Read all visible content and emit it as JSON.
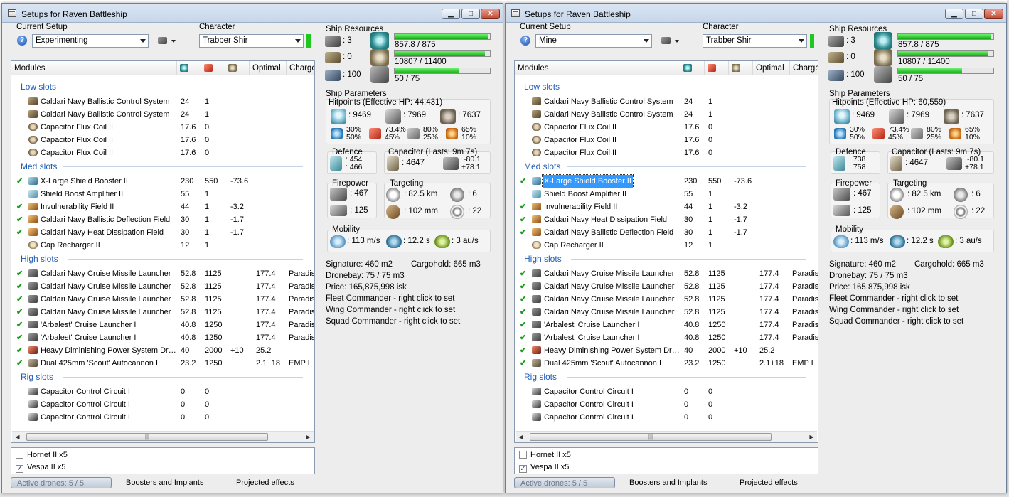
{
  "windows": [
    {
      "title": "Setups for Raven Battleship",
      "setup_label": "Current Setup",
      "setup_value": "Experimenting",
      "character_label": "Character",
      "character_value": "Trabber Shir",
      "columns": [
        "Modules",
        "",
        "",
        "",
        "Optimal",
        "Charge"
      ],
      "groups": [
        {
          "name": "Low slots",
          "rows": [
            {
              "check": false,
              "icon": "bcs",
              "name": "Caldari Navy Ballistic Control System",
              "c1": "24",
              "c2": "1",
              "c3": "",
              "c4": "",
              "c5": ""
            },
            {
              "check": false,
              "icon": "bcs",
              "name": "Caldari Navy Ballistic Control System",
              "c1": "24",
              "c2": "1",
              "c3": "",
              "c4": "",
              "c5": ""
            },
            {
              "check": false,
              "icon": "flux",
              "name": "Capacitor Flux Coil II",
              "c1": "17.6",
              "c2": "0",
              "c3": "",
              "c4": "",
              "c5": ""
            },
            {
              "check": false,
              "icon": "flux",
              "name": "Capacitor Flux Coil II",
              "c1": "17.6",
              "c2": "0",
              "c3": "",
              "c4": "",
              "c5": ""
            },
            {
              "check": false,
              "icon": "flux",
              "name": "Capacitor Flux Coil II",
              "c1": "17.6",
              "c2": "0",
              "c3": "",
              "c4": "",
              "c5": ""
            }
          ]
        },
        {
          "name": "Med slots",
          "rows": [
            {
              "check": true,
              "icon": "shield",
              "name": "X-Large Shield Booster II",
              "c1": "230",
              "c2": "550",
              "c3": "-73.6",
              "c4": "",
              "c5": ""
            },
            {
              "check": false,
              "icon": "amp",
              "name": "Shield Boost Amplifier II",
              "c1": "55",
              "c2": "1",
              "c3": "",
              "c4": "",
              "c5": ""
            },
            {
              "check": true,
              "icon": "invul",
              "name": "Invulnerability Field II",
              "c1": "44",
              "c2": "1",
              "c3": "-3.2",
              "c4": "",
              "c5": ""
            },
            {
              "check": true,
              "icon": "invul",
              "name": "Caldari Navy Ballistic Deflection Field",
              "c1": "30",
              "c2": "1",
              "c3": "-1.7",
              "c4": "",
              "c5": ""
            },
            {
              "check": true,
              "icon": "invul",
              "name": "Caldari Navy Heat Dissipation Field",
              "c1": "30",
              "c2": "1",
              "c3": "-1.7",
              "c4": "",
              "c5": ""
            },
            {
              "check": false,
              "icon": "cap",
              "name": "Cap Recharger II",
              "c1": "12",
              "c2": "1",
              "c3": "",
              "c4": "",
              "c5": ""
            }
          ]
        },
        {
          "name": "High slots",
          "rows": [
            {
              "check": true,
              "icon": "launch",
              "name": "Caldari Navy Cruise Missile Launcher",
              "c1": "52.8",
              "c2": "1125",
              "c3": "",
              "c4": "177.4",
              "c5": "Paradis"
            },
            {
              "check": true,
              "icon": "launch",
              "name": "Caldari Navy Cruise Missile Launcher",
              "c1": "52.8",
              "c2": "1125",
              "c3": "",
              "c4": "177.4",
              "c5": "Paradis"
            },
            {
              "check": true,
              "icon": "launch",
              "name": "Caldari Navy Cruise Missile Launcher",
              "c1": "52.8",
              "c2": "1125",
              "c3": "",
              "c4": "177.4",
              "c5": "Paradis"
            },
            {
              "check": true,
              "icon": "launch",
              "name": "Caldari Navy Cruise Missile Launcher",
              "c1": "52.8",
              "c2": "1125",
              "c3": "",
              "c4": "177.4",
              "c5": "Paradis"
            },
            {
              "check": true,
              "icon": "launch",
              "name": "'Arbalest' Cruise Launcher I",
              "c1": "40.8",
              "c2": "1250",
              "c3": "",
              "c4": "177.4",
              "c5": "Paradis"
            },
            {
              "check": true,
              "icon": "launch",
              "name": "'Arbalest' Cruise Launcher I",
              "c1": "40.8",
              "c2": "1250",
              "c3": "",
              "c4": "177.4",
              "c5": "Paradis"
            },
            {
              "check": true,
              "icon": "neut",
              "name": "Heavy Diminishing Power System Drai...",
              "c1": "40",
              "c2": "2000",
              "c3": "+10",
              "c4": "25.2",
              "c5": ""
            },
            {
              "check": true,
              "icon": "gun",
              "name": "Dual 425mm 'Scout' Autocannon I",
              "c1": "23.2",
              "c2": "1250",
              "c3": "",
              "c4": "2.1+18",
              "c5": "EMP L"
            }
          ]
        },
        {
          "name": "Rig slots",
          "rows": [
            {
              "check": false,
              "icon": "rig",
              "name": "Capacitor Control Circuit I",
              "c1": "0",
              "c2": "0",
              "c3": "",
              "c4": "",
              "c5": ""
            },
            {
              "check": false,
              "icon": "rig",
              "name": "Capacitor Control Circuit I",
              "c1": "0",
              "c2": "0",
              "c3": "",
              "c4": "",
              "c5": ""
            },
            {
              "check": false,
              "icon": "rig",
              "name": "Capacitor Control Circuit I",
              "c1": "0",
              "c2": "0",
              "c3": "",
              "c4": "",
              "c5": ""
            }
          ]
        }
      ],
      "drones": [
        {
          "checked": false,
          "label": "Hornet II x5"
        },
        {
          "checked": true,
          "label": "Vespa II x5"
        }
      ],
      "tabs": [
        "Active drones: 5 / 5",
        "Boosters and Implants",
        "Projected effects"
      ],
      "resources": {
        "title": "Ship Resources",
        "turrets": ": 3",
        "launchers": ": 0",
        "calibration": ": 100",
        "cpu": "857.8 / 875",
        "cpu_fill": 0.98,
        "power": "10807 / 11400",
        "power_fill": 0.95,
        "drone_bw": "50 / 75",
        "drone_fill": 0.67
      },
      "params": {
        "title": "Ship Parameters",
        "hp_title": "Hitpoints (Effective HP: 44,431)",
        "shield_hp": ": 9469",
        "armor_hp": ": 7969",
        "hull_hp": ": 7637",
        "res_shield": [
          "30%",
          "50%"
        ],
        "res_armor": [
          "73.4%",
          "45%"
        ],
        "res_kin": [
          "80%",
          "25%"
        ],
        "res_therm": [
          "65%",
          "10%"
        ],
        "defence_title": "Defence",
        "defence_vals": [
          ": 454",
          ": 466"
        ],
        "cap_title": "Capacitor (Lasts: 9m 7s)",
        "cap_val": ": 4647",
        "cap_delta": [
          "-80.1",
          "+78.1"
        ],
        "fire_title": "Firepower",
        "fire_vals": [
          ": 467",
          ": 125"
        ],
        "target_title": "Targeting",
        "target_range": ": 82.5 km",
        "target_count": ": 6",
        "target_res": ": 102 mm",
        "target_sens": ": 22",
        "mob_title": "Mobility",
        "mob_speed": ": 113 m/s",
        "mob_align": ": 12.2 s",
        "mob_warp": ": 3 au/s"
      },
      "info": {
        "signature": "Signature: 460 m2",
        "cargohold": "Cargohold: 665 m3",
        "dronebay": "Dronebay: 75 / 75 m3",
        "price": "Price: 165,875,998 isk",
        "fleet": "Fleet Commander - right click to set",
        "wing": "Wing Commander - right click to set",
        "squad": "Squad Commander - right click to set"
      }
    },
    {
      "title": "Setups for Raven Battleship",
      "setup_label": "Current Setup",
      "setup_value": "Mine",
      "character_label": "Character",
      "character_value": "Trabber Shir",
      "columns": [
        "Modules",
        "",
        "",
        "",
        "Optimal",
        "Charges"
      ],
      "groups": [
        {
          "name": "Low slots",
          "rows": [
            {
              "check": false,
              "icon": "bcs",
              "name": "Caldari Navy Ballistic Control System",
              "c1": "24",
              "c2": "1",
              "c3": "",
              "c4": "",
              "c5": ""
            },
            {
              "check": false,
              "icon": "bcs",
              "name": "Caldari Navy Ballistic Control System",
              "c1": "24",
              "c2": "1",
              "c3": "",
              "c4": "",
              "c5": ""
            },
            {
              "check": false,
              "icon": "flux",
              "name": "Capacitor Flux Coil II",
              "c1": "17.6",
              "c2": "0",
              "c3": "",
              "c4": "",
              "c5": ""
            },
            {
              "check": false,
              "icon": "flux",
              "name": "Capacitor Flux Coil II",
              "c1": "17.6",
              "c2": "0",
              "c3": "",
              "c4": "",
              "c5": ""
            },
            {
              "check": false,
              "icon": "flux",
              "name": "Capacitor Flux Coil II",
              "c1": "17.6",
              "c2": "0",
              "c3": "",
              "c4": "",
              "c5": ""
            }
          ]
        },
        {
          "name": "Med slots",
          "rows": [
            {
              "check": true,
              "icon": "shield",
              "name": "X-Large Shield Booster II",
              "c1": "230",
              "c2": "550",
              "c3": "-73.6",
              "c4": "",
              "c5": "",
              "selected": true
            },
            {
              "check": false,
              "icon": "amp",
              "name": "Shield Boost Amplifier II",
              "c1": "55",
              "c2": "1",
              "c3": "",
              "c4": "",
              "c5": ""
            },
            {
              "check": true,
              "icon": "invul",
              "name": "Invulnerability Field II",
              "c1": "44",
              "c2": "1",
              "c3": "-3.2",
              "c4": "",
              "c5": ""
            },
            {
              "check": true,
              "icon": "invul",
              "name": "Caldari Navy Heat Dissipation Field",
              "c1": "30",
              "c2": "1",
              "c3": "-1.7",
              "c4": "",
              "c5": ""
            },
            {
              "check": true,
              "icon": "invul",
              "name": "Caldari Navy Ballistic Deflection Field",
              "c1": "30",
              "c2": "1",
              "c3": "-1.7",
              "c4": "",
              "c5": ""
            },
            {
              "check": false,
              "icon": "cap",
              "name": "Cap Recharger II",
              "c1": "12",
              "c2": "1",
              "c3": "",
              "c4": "",
              "c5": ""
            }
          ]
        },
        {
          "name": "High slots",
          "rows": [
            {
              "check": true,
              "icon": "launch",
              "name": "Caldari Navy Cruise Missile Launcher",
              "c1": "52.8",
              "c2": "1125",
              "c3": "",
              "c4": "177.4",
              "c5": "Paradise I"
            },
            {
              "check": true,
              "icon": "launch",
              "name": "Caldari Navy Cruise Missile Launcher",
              "c1": "52.8",
              "c2": "1125",
              "c3": "",
              "c4": "177.4",
              "c5": "Paradise I"
            },
            {
              "check": true,
              "icon": "launch",
              "name": "Caldari Navy Cruise Missile Launcher",
              "c1": "52.8",
              "c2": "1125",
              "c3": "",
              "c4": "177.4",
              "c5": "Paradise I"
            },
            {
              "check": true,
              "icon": "launch",
              "name": "Caldari Navy Cruise Missile Launcher",
              "c1": "52.8",
              "c2": "1125",
              "c3": "",
              "c4": "177.4",
              "c5": "Paradise I"
            },
            {
              "check": true,
              "icon": "launch",
              "name": "'Arbalest' Cruise Launcher I",
              "c1": "40.8",
              "c2": "1250",
              "c3": "",
              "c4": "177.4",
              "c5": "Paradise I"
            },
            {
              "check": true,
              "icon": "launch",
              "name": "'Arbalest' Cruise Launcher I",
              "c1": "40.8",
              "c2": "1250",
              "c3": "",
              "c4": "177.4",
              "c5": "Paradise I"
            },
            {
              "check": true,
              "icon": "neut",
              "name": "Heavy Diminishing Power System Drai...",
              "c1": "40",
              "c2": "2000",
              "c3": "+10",
              "c4": "25.2",
              "c5": ""
            },
            {
              "check": true,
              "icon": "gun",
              "name": "Dual 425mm 'Scout' Autocannon I",
              "c1": "23.2",
              "c2": "1250",
              "c3": "",
              "c4": "2.1+18",
              "c5": "EMP L"
            }
          ]
        },
        {
          "name": "Rig slots",
          "rows": [
            {
              "check": false,
              "icon": "rig",
              "name": "Capacitor Control Circuit I",
              "c1": "0",
              "c2": "0",
              "c3": "",
              "c4": "",
              "c5": ""
            },
            {
              "check": false,
              "icon": "rig",
              "name": "Capacitor Control Circuit I",
              "c1": "0",
              "c2": "0",
              "c3": "",
              "c4": "",
              "c5": ""
            },
            {
              "check": false,
              "icon": "rig",
              "name": "Capacitor Control Circuit I",
              "c1": "0",
              "c2": "0",
              "c3": "",
              "c4": "",
              "c5": ""
            }
          ]
        }
      ],
      "drones": [
        {
          "checked": false,
          "label": "Hornet II x5"
        },
        {
          "checked": true,
          "label": "Vespa II x5"
        }
      ],
      "tabs": [
        "Active drones: 5 / 5",
        "Boosters and Implants",
        "Projected effects"
      ],
      "resources": {
        "title": "Ship Resources",
        "turrets": ": 3",
        "launchers": ": 0",
        "calibration": ": 100",
        "cpu": "857.8 / 875",
        "cpu_fill": 0.98,
        "power": "10807 / 11400",
        "power_fill": 0.95,
        "drone_bw": "50 / 75",
        "drone_fill": 0.67
      },
      "params": {
        "title": "Ship Parameters",
        "hp_title": "Hitpoints (Effective HP: 60,559)",
        "shield_hp": ": 9469",
        "armor_hp": ": 7969",
        "hull_hp": ": 7637",
        "res_shield": [
          "30%",
          "50%"
        ],
        "res_armor": [
          "73.4%",
          "45%"
        ],
        "res_kin": [
          "80%",
          "25%"
        ],
        "res_therm": [
          "65%",
          "10%"
        ],
        "defence_title": "Defence",
        "defence_vals": [
          ": 738",
          ": 758"
        ],
        "cap_title": "Capacitor (Lasts: 9m 7s)",
        "cap_val": ": 4647",
        "cap_delta": [
          "-80.1",
          "+78.1"
        ],
        "fire_title": "Firepower",
        "fire_vals": [
          ": 467",
          ": 125"
        ],
        "target_title": "Targeting",
        "target_range": ": 82.5 km",
        "target_count": ": 6",
        "target_res": ": 102 mm",
        "target_sens": ": 22",
        "mob_title": "Mobility",
        "mob_speed": ": 113 m/s",
        "mob_align": ": 12.2 s",
        "mob_warp": ": 3 au/s"
      },
      "info": {
        "signature": "Signature: 460 m2",
        "cargohold": "Cargohold: 665 m3",
        "dronebay": "Dronebay: 75 / 75 m3",
        "price": "Price: 165,875,998 isk",
        "fleet": "Fleet Commander - right click to set",
        "wing": "Wing Commander - right click to set",
        "squad": "Squad Commander - right click to set"
      }
    }
  ],
  "colors": {
    "group_header": "#1e5db5",
    "check": "#1c9a1c",
    "bar_fill": "#15a815",
    "selection": "#3399ff",
    "title_bg": "#c6d6ea"
  },
  "icons": [
    "help-icon",
    "gear-icon",
    "cpu-icon",
    "power-grid-icon",
    "drone-bay-icon",
    "turret-icon",
    "launcher-icon",
    "calibration-icon",
    "shield-icon",
    "armor-icon",
    "hull-icon"
  ]
}
